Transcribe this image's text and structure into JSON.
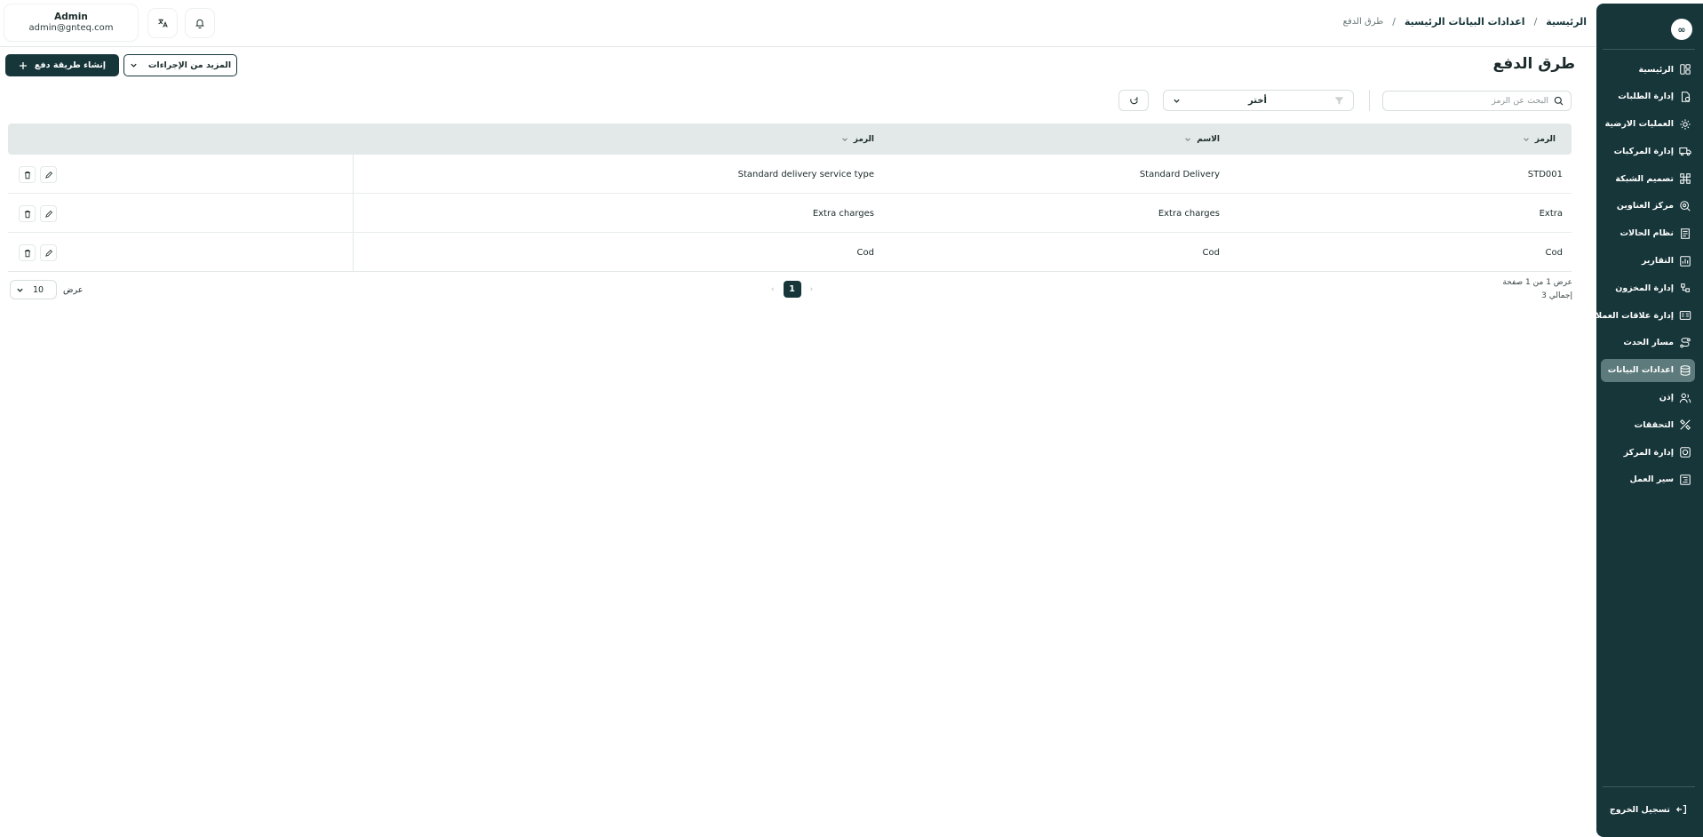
{
  "user": {
    "name": "Admin",
    "email": "admin@gnteq.com"
  },
  "breadcrumb": {
    "home": "الرئيسية",
    "mid": "اعدادات البيانات الرئيسية",
    "current": "طرق الدفع",
    "sep": "/"
  },
  "sidebar": {
    "logo": "∞",
    "items": [
      {
        "label": "الرئيسية",
        "icon": "dashboard-icon",
        "active": false
      },
      {
        "label": "إدارة الطلبات",
        "icon": "orders-icon",
        "active": false
      },
      {
        "label": "العمليات الارضية",
        "icon": "ground-ops-icon",
        "active": false
      },
      {
        "label": "إدارة المركبات",
        "icon": "truck-icon",
        "active": false
      },
      {
        "label": "تصميم الشبكة",
        "icon": "network-icon",
        "active": false
      },
      {
        "label": "مركز العناوين",
        "icon": "address-icon",
        "active": false
      },
      {
        "label": "نظام الحالات",
        "icon": "status-icon",
        "active": false
      },
      {
        "label": "التقارير",
        "icon": "reports-icon",
        "active": false
      },
      {
        "label": "إدارة المخزون",
        "icon": "inventory-icon",
        "active": false
      },
      {
        "label": "إدارة علاقات العملاء",
        "icon": "crm-icon",
        "active": false
      },
      {
        "label": "مسار الحدث",
        "icon": "route-icon",
        "active": false
      },
      {
        "label": "اعدادات البيانات",
        "icon": "database-icon",
        "active": true
      },
      {
        "label": "إذن",
        "icon": "permission-icon",
        "active": false
      },
      {
        "label": "التحققات",
        "icon": "validation-icon",
        "active": false
      },
      {
        "label": "إدارة المركز",
        "icon": "center-icon",
        "active": false
      },
      {
        "label": "سير العمل",
        "icon": "workflow-icon",
        "active": false
      }
    ],
    "logout": "تسجيل الخروج"
  },
  "page": {
    "title": "طرق الدفع",
    "create_button": "إنشاء طريقة دفع",
    "more_actions": "المزيد من الإجراءات",
    "search_placeholder": "البحث عن الرمز",
    "select_value": "أختر"
  },
  "table": {
    "headers": {
      "code": "الرمز",
      "name": "الاسم",
      "description": "الرمز"
    },
    "rows": [
      {
        "code": "STD001",
        "name": "Standard Delivery",
        "description": "Standard delivery service type"
      },
      {
        "code": "Extra",
        "name": "Extra charges",
        "description": "Extra charges"
      },
      {
        "code": "Cod",
        "name": "Cod",
        "description": "Cod"
      }
    ]
  },
  "footer": {
    "summary_line1": "عرض 1 من 1 صفحة",
    "summary_line2": "إجمالي 3",
    "current_page": "1",
    "per_page": "10",
    "per_page_label": "عرض"
  },
  "colors": {
    "primary": "#17363a",
    "header_bg": "#e3e8e8",
    "active_nav": "#5d7a7c"
  }
}
